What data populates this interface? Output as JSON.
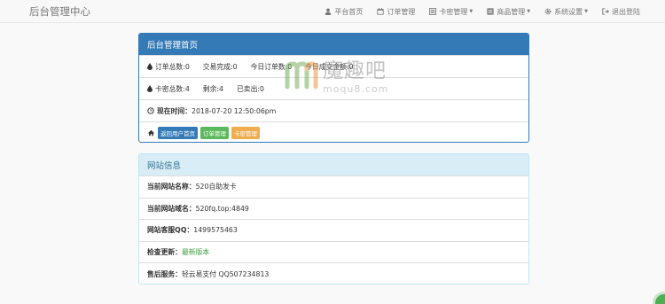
{
  "app": {
    "title": "后台管理中心"
  },
  "nav": [
    {
      "label": "平台首页",
      "icon": "user-icon",
      "dropdown": false
    },
    {
      "label": "订单管理",
      "icon": "calendar-icon",
      "dropdown": false
    },
    {
      "label": "卡密管理",
      "icon": "card-list-icon",
      "dropdown": true
    },
    {
      "label": "商品管理",
      "icon": "list-icon",
      "dropdown": true
    },
    {
      "label": "系统设置",
      "icon": "gear-icon",
      "dropdown": true
    },
    {
      "label": "退出登陆",
      "icon": "logout-icon",
      "dropdown": false
    }
  ],
  "dashboard": {
    "title": "后台管理首页",
    "orders": [
      {
        "label": "订单总数:",
        "value": "0"
      },
      {
        "label": "交易完成:",
        "value": "0"
      },
      {
        "label": "今日订单数:",
        "value": "0"
      },
      {
        "label": "今日成交金额:",
        "value": "0"
      }
    ],
    "cards": [
      {
        "label": "卡密总数:",
        "value": "4"
      },
      {
        "label": "剩余:",
        "value": "4"
      },
      {
        "label": "已卖出:",
        "value": "0"
      }
    ],
    "time_label": "现在时间：",
    "time_value": "2018-07-20 12:50:06pm",
    "buttons": {
      "home": "返回用户首页",
      "orders": "订单管理",
      "cards": "卡密管理"
    }
  },
  "site_info": {
    "title": "网站信息",
    "rows": [
      {
        "label": "当前网站名称：",
        "value": "520自助发卡"
      },
      {
        "label": "当前网站域名：",
        "value": "520fq.top:4849"
      },
      {
        "label": "网站客服QQ：",
        "value": "1499575463"
      },
      {
        "label": "检查更新：",
        "value": "最新版本"
      },
      {
        "label": "售后服务：",
        "value": "轻云易支付 QQ507234813"
      }
    ]
  },
  "watermark": {
    "title": "魔趣吧",
    "url": "moqu8.com"
  },
  "colors": {
    "primary": "#337ab7",
    "info_bg": "#d9edf7",
    "success": "#5cb85c",
    "warning": "#f0ad4e"
  }
}
